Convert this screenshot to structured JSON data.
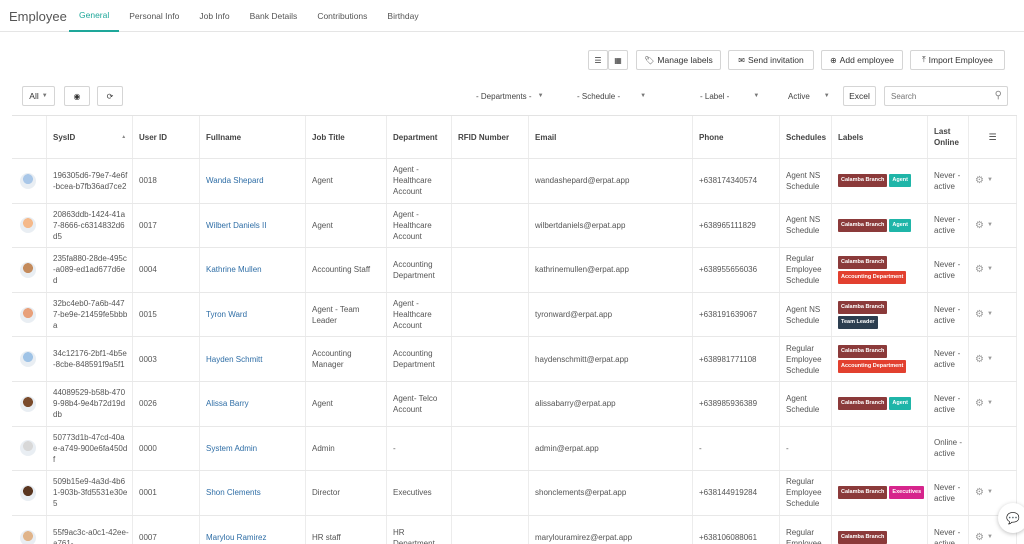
{
  "app": {
    "title": "Employee"
  },
  "tabs": [
    "General",
    "Personal Info",
    "Job Info",
    "Bank Details",
    "Contributions",
    "Birthday"
  ],
  "toolbar": {
    "list_view_icon": "list-icon",
    "grid_view_icon": "grid-icon",
    "manage_labels": "Manage labels",
    "send_invitation": "Send invitation",
    "add_employee": "Add employee",
    "import_employee": "Import Employee"
  },
  "filters": {
    "page_size": "All",
    "departments": "- Departments -",
    "schedule": "- Schedule -",
    "label": "- Label -",
    "status": "Active",
    "excel": "Excel",
    "search_placeholder": "Search"
  },
  "columns": [
    "",
    "SysID",
    "User ID",
    "Fullname",
    "Job Title",
    "Department",
    "RFID Number",
    "Email",
    "Phone",
    "Schedules",
    "Labels",
    "Last Online",
    ""
  ],
  "colors": {
    "accent": "#1ea79a",
    "link": "#2f6ea6",
    "label_calamba": "#8b3a3a",
    "label_agent": "#1fb5a8",
    "label_accounting": "#e2402f",
    "label_team_leader": "#2c3e50",
    "label_executives": "#d6258c"
  },
  "rows": [
    {
      "sysid": "196305d6-79e7-4e6f-bcea-b7fb36ad7ce2",
      "userid": "0018",
      "fullname": "Wanda Shepard",
      "job": "Agent",
      "dept": "Agent - Healthcare Account",
      "rfid": "",
      "email": "wandashepard@erpat.app",
      "phone": "+638174340574",
      "schedule": "Agent NS Schedule",
      "labels": [
        "Calamba Branch",
        "Agent"
      ],
      "last": "Never - active",
      "action": true
    },
    {
      "sysid": "20863ddb-1424-41a7-8666-c6314832d6d5",
      "userid": "0017",
      "fullname": "Wilbert Daniels II",
      "job": "Agent",
      "dept": "Agent - Healthcare Account",
      "rfid": "",
      "email": "wilbertdaniels@erpat.app",
      "phone": "+638965111829",
      "schedule": "Agent NS Schedule",
      "labels": [
        "Calamba Branch",
        "Agent"
      ],
      "last": "Never - active",
      "action": true
    },
    {
      "sysid": "235fa880-28de-495c-a089-ed1ad677d6ed",
      "userid": "0004",
      "fullname": "Kathrine Mullen",
      "job": "Accounting Staff",
      "dept": "Accounting Department",
      "rfid": "",
      "email": "kathrinemullen@erpat.app",
      "phone": "+638955656036",
      "schedule": "Regular Employee Schedule",
      "labels": [
        "Calamba Branch",
        "Accounting Department"
      ],
      "last": "Never - active",
      "action": true
    },
    {
      "sysid": "32bc4eb0-7a6b-4477-be9e-21459fe5bbba",
      "userid": "0015",
      "fullname": "Tyron Ward",
      "job": "Agent - Team Leader",
      "dept": "Agent - Healthcare Account",
      "rfid": "",
      "email": "tyronward@erpat.app",
      "phone": "+638191639067",
      "schedule": "Agent NS Schedule",
      "labels": [
        "Calamba Branch",
        "Team Leader"
      ],
      "last": "Never - active",
      "action": true
    },
    {
      "sysid": "34c12176-2bf1-4b5e-8cbe-848591f9a5f1",
      "userid": "0003",
      "fullname": "Hayden Schmitt",
      "job": "Accounting Manager",
      "dept": "Accounting Department",
      "rfid": "",
      "email": "haydenschmitt@erpat.app",
      "phone": "+638981771108",
      "schedule": "Regular Employee Schedule",
      "labels": [
        "Calamba Branch",
        "Accounting Department"
      ],
      "last": "Never - active",
      "action": true
    },
    {
      "sysid": "44089529-b58b-4709-98b4-9e4b72d19ddb",
      "userid": "0026",
      "fullname": "Alissa Barry",
      "job": "Agent",
      "dept": "Agent- Telco Account",
      "rfid": "",
      "email": "alissabarry@erpat.app",
      "phone": "+638985936389",
      "schedule": "Agent Schedule",
      "labels": [
        "Calamba Branch",
        "Agent"
      ],
      "last": "Never - active",
      "action": true
    },
    {
      "sysid": "50773d1b-47cd-40ae-a749-900e6fa450df",
      "userid": "0000",
      "fullname": "System Admin",
      "job": "Admin",
      "dept": "-",
      "rfid": "",
      "email": "admin@erpat.app",
      "phone": "-",
      "schedule": "-",
      "labels": [],
      "last": "Online - active",
      "action": false
    },
    {
      "sysid": "509b15e9-4a3d-4b61-903b-3fd5531e30e5",
      "userid": "0001",
      "fullname": "Shon Clements",
      "job": "Director",
      "dept": "Executives",
      "rfid": "",
      "email": "shonclements@erpat.app",
      "phone": "+638144919284",
      "schedule": "Regular Employee Schedule",
      "labels": [
        "Calamba Branch",
        "Executives"
      ],
      "last": "Never - active",
      "action": true
    },
    {
      "sysid": "55f9ac3c-a0c1-42ee-a761-",
      "userid": "0007",
      "fullname": "Marylou Ramirez",
      "job": "HR staff",
      "dept": "HR Department",
      "rfid": "",
      "email": "marylouramirez@erpat.app",
      "phone": "+638106088061",
      "schedule": "Regular Employee",
      "labels": [
        "Calamba Branch"
      ],
      "last": "Never - active",
      "action": true
    }
  ]
}
